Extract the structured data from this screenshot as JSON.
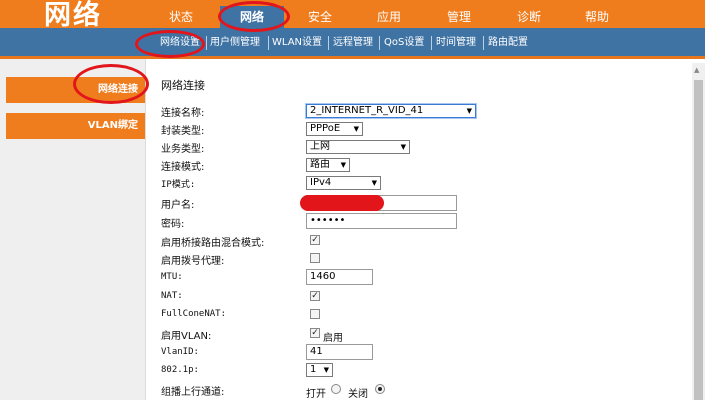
{
  "header": {
    "logo": "网络",
    "tabs": [
      {
        "label": "状态"
      },
      {
        "label": "网络",
        "active": true
      },
      {
        "label": "安全"
      },
      {
        "label": "应用"
      },
      {
        "label": "管理"
      },
      {
        "label": "诊断"
      },
      {
        "label": "帮助"
      }
    ],
    "subtabs": [
      {
        "label": "网络设置",
        "active": true
      },
      {
        "label": "用户侧管理"
      },
      {
        "label": "WLAN设置"
      },
      {
        "label": "远程管理"
      },
      {
        "label": "QoS设置"
      },
      {
        "label": "时间管理"
      },
      {
        "label": "路由配置"
      }
    ]
  },
  "sidebar": {
    "items": [
      {
        "label": "网络连接",
        "active": true
      },
      {
        "label": "VLAN绑定"
      }
    ]
  },
  "form": {
    "title": "网络连接",
    "connection_name": {
      "label": "连接名称:",
      "value": "2_INTERNET_R_VID_41"
    },
    "encapsulation": {
      "label": "封装类型:",
      "value": "PPPoE"
    },
    "service_type": {
      "label": "业务类型:",
      "value": "上网"
    },
    "connection_mode": {
      "label": "连接模式:",
      "value": "路由"
    },
    "ip_mode": {
      "label": "IP模式:",
      "value": "IPv4"
    },
    "username": {
      "label": "用户名:",
      "value": ""
    },
    "password": {
      "label": "密码:",
      "value": "••••••"
    },
    "bridge_route_mix": {
      "label": "启用桥接路由混合模式:",
      "checked": true
    },
    "dial_proxy": {
      "label": "启用拨号代理:",
      "checked": false
    },
    "mtu": {
      "label": "MTU:",
      "value": "1460"
    },
    "nat": {
      "label": "NAT:",
      "checked": true
    },
    "full_cone_nat": {
      "label": "FullConeNAT:",
      "checked": false
    },
    "enable_vlan": {
      "label": "启用VLAN:",
      "checked": true,
      "text": "启用"
    },
    "vlan_id": {
      "label": "VlanID:",
      "value": "41"
    },
    "dot1p": {
      "label": "802.1p:",
      "value": "1"
    },
    "multicast_upstream": {
      "label": "组播上行通道:",
      "on_label": "打开",
      "off_label": "关闭",
      "selected": "关闭"
    }
  },
  "colors": {
    "header_orange": "#ef7d1e",
    "nav_blue": "#3f73a4",
    "annotation_red": "#e2151b"
  },
  "icons": {
    "dropdown": "dropdown-arrow-icon",
    "check": "check-icon",
    "scroll_up": "scroll-up-arrow-icon"
  }
}
